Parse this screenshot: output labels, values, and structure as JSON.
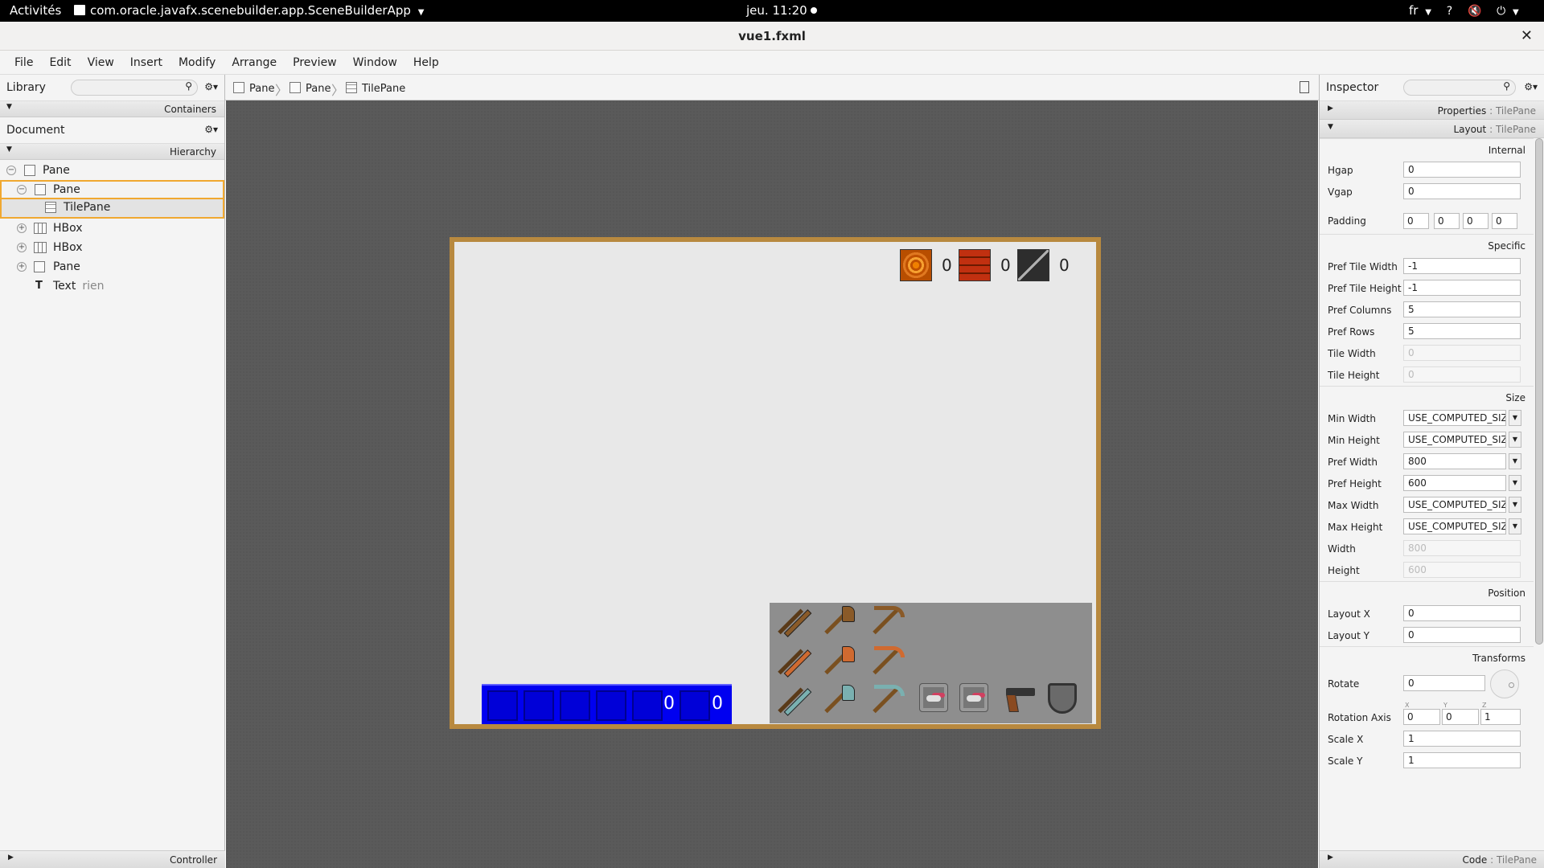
{
  "topbar": {
    "activities": "Activités",
    "app_name": "com.oracle.javafx.scenebuilder.app.SceneBuilderApp",
    "clock": "jeu. 11:20",
    "lang": "fr"
  },
  "window": {
    "title": "vue1.fxml"
  },
  "menu": [
    "File",
    "Edit",
    "View",
    "Insert",
    "Modify",
    "Arrange",
    "Preview",
    "Window",
    "Help"
  ],
  "library": {
    "label": "Library",
    "containers_label": "Containers"
  },
  "document": {
    "label": "Document",
    "hierarchy_label": "Hierarchy",
    "tree": [
      {
        "name": "Pane",
        "sub": ""
      },
      {
        "name": "Pane",
        "sub": ""
      },
      {
        "name": "TilePane",
        "sub": ""
      },
      {
        "name": "HBox",
        "sub": ""
      },
      {
        "name": "HBox",
        "sub": ""
      },
      {
        "name": "Pane",
        "sub": ""
      },
      {
        "name": "Text",
        "sub": "rien"
      }
    ],
    "controller_label": "Controller"
  },
  "breadcrumb": [
    "Pane",
    "Pane",
    "TilePane"
  ],
  "scene": {
    "resources": [
      "0",
      "0",
      "0"
    ],
    "inventory": [
      "0",
      "0"
    ]
  },
  "inspector": {
    "label": "Inspector",
    "properties_label": "Properties",
    "properties_type": "TilePane",
    "layout_label": "Layout",
    "layout_type": "TilePane",
    "groups": {
      "internal": "Internal",
      "specific": "Specific",
      "size": "Size",
      "position": "Position",
      "transforms": "Transforms"
    },
    "hgap": {
      "label": "Hgap",
      "value": "0"
    },
    "vgap": {
      "label": "Vgap",
      "value": "0"
    },
    "padding": {
      "label": "Padding",
      "values": [
        "0",
        "0",
        "0",
        "0"
      ]
    },
    "pref_tile_width": {
      "label": "Pref Tile Width",
      "value": "-1"
    },
    "pref_tile_height": {
      "label": "Pref Tile Height",
      "value": "-1"
    },
    "pref_columns": {
      "label": "Pref Columns",
      "value": "5"
    },
    "pref_rows": {
      "label": "Pref Rows",
      "value": "5"
    },
    "tile_width": {
      "label": "Tile Width",
      "value": "0"
    },
    "tile_height": {
      "label": "Tile Height",
      "value": "0"
    },
    "min_width": {
      "label": "Min Width",
      "value": "USE_COMPUTED_SIZE"
    },
    "min_height": {
      "label": "Min Height",
      "value": "USE_COMPUTED_SIZE"
    },
    "pref_width": {
      "label": "Pref Width",
      "value": "800"
    },
    "pref_height": {
      "label": "Pref Height",
      "value": "600"
    },
    "max_width": {
      "label": "Max Width",
      "value": "USE_COMPUTED_SIZE"
    },
    "max_height": {
      "label": "Max Height",
      "value": "USE_COMPUTED_SIZE"
    },
    "width": {
      "label": "Width",
      "value": "800"
    },
    "height": {
      "label": "Height",
      "value": "600"
    },
    "layout_x": {
      "label": "Layout X",
      "value": "0"
    },
    "layout_y": {
      "label": "Layout Y",
      "value": "0"
    },
    "rotate": {
      "label": "Rotate",
      "value": "0"
    },
    "rotation_axis": {
      "label": "Rotation Axis",
      "axes": [
        "X",
        "Y",
        "Z"
      ],
      "values": [
        "0",
        "0",
        "1"
      ]
    },
    "scale_x": {
      "label": "Scale X",
      "value": "1"
    },
    "scale_y": {
      "label": "Scale Y",
      "value": "1"
    },
    "code_label": "Code",
    "code_type": "TilePane"
  }
}
